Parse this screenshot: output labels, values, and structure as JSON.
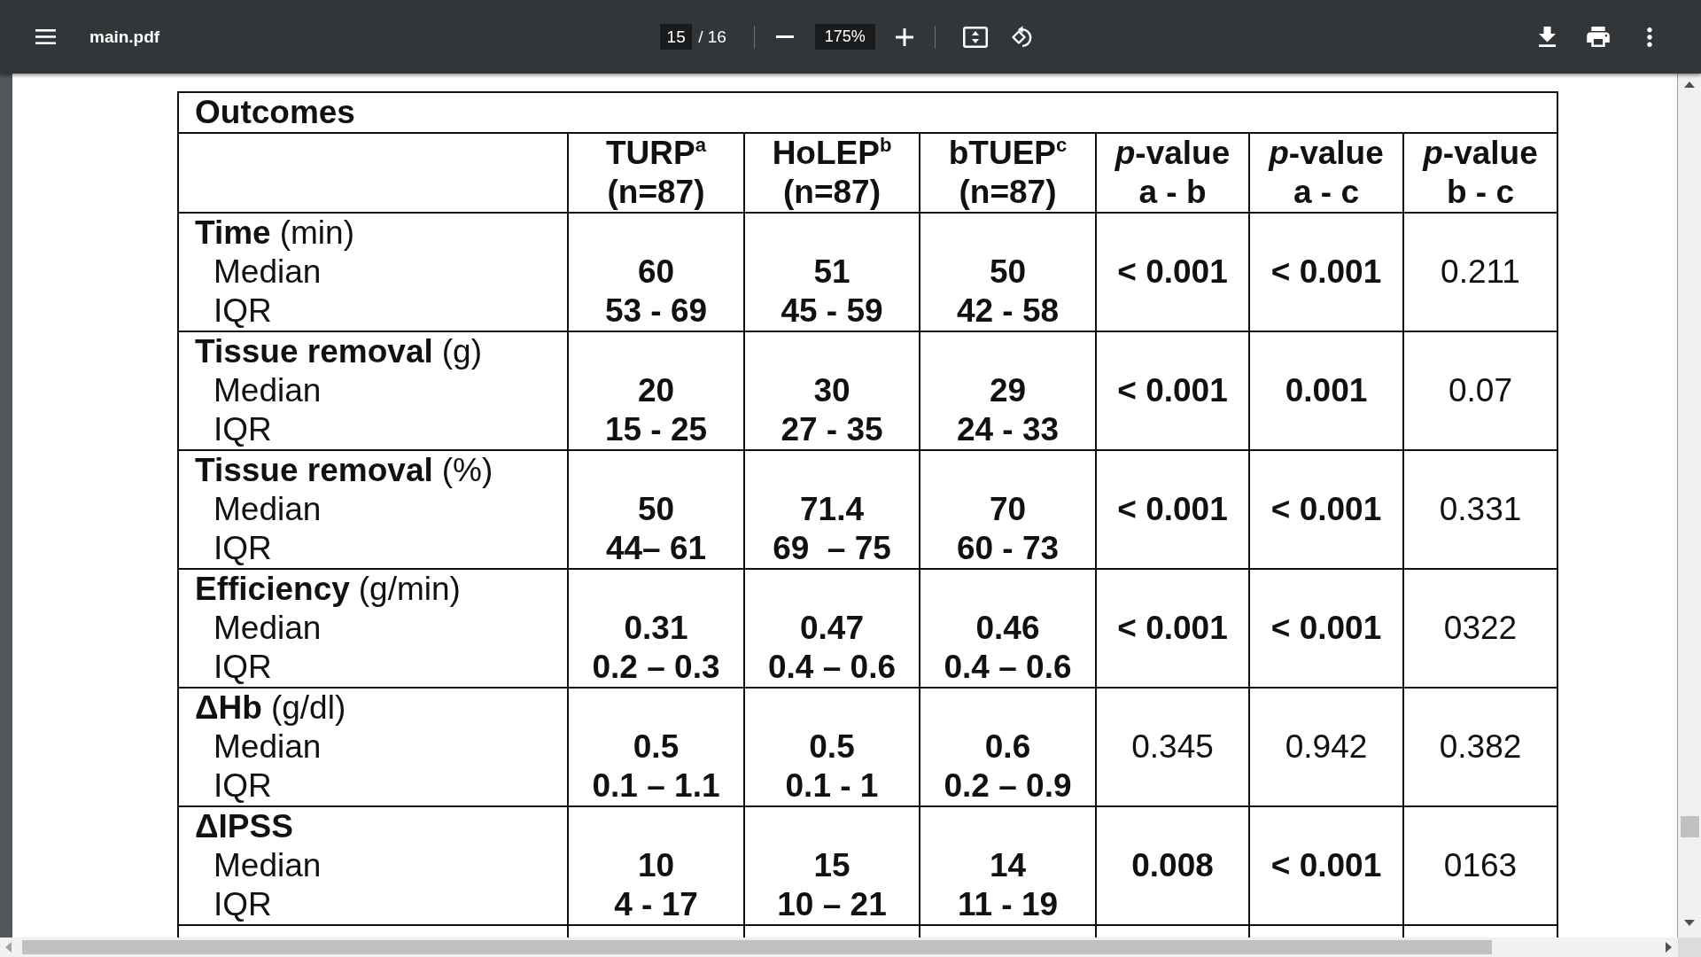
{
  "toolbar": {
    "file_name": "main.pdf",
    "page": "15",
    "page_total": "/ 16",
    "zoom": "175%"
  },
  "table": {
    "title": "Outcomes",
    "columns": [
      {
        "line_1": "TURP$^{a}$",
        "line_2": "(n=87)"
      },
      {
        "line_1": "HoLEP$^{b}$",
        "line_2": "(n=87)"
      },
      {
        "line_1": "bTUEP$^{c}$",
        "line_2": "(n=87)"
      },
      {
        "line_1": "*p*-value",
        "line_2": "a - b"
      },
      {
        "line_1": "*p*-value",
        "line_2": "a - c"
      },
      {
        "line_1": "*p*-value",
        "line_2": "b - c"
      }
    ],
    "rows": [
      {
        "label": "Time",
        "unit": "(min)",
        "median_label": "Median",
        "iqr_label": "IQR",
        "groups": [
          {
            "median": "60",
            "iqr": "53 - 69"
          },
          {
            "median": "51",
            "iqr": "45 - 59"
          },
          {
            "median": "50",
            "iqr": "42 - 58"
          }
        ],
        "p_values": [
          {
            "text": "< 0.001",
            "significant": true
          },
          {
            "text": "< 0.001",
            "significant": true
          },
          {
            "text": "0.211",
            "significant": false
          }
        ]
      },
      {
        "label": "Tissue removal",
        "unit": "(g)",
        "median_label": "Median",
        "iqr_label": "IQR",
        "groups": [
          {
            "median": "20",
            "iqr": "15 - 25"
          },
          {
            "median": "30",
            "iqr": "27 - 35"
          },
          {
            "median": "29",
            "iqr": "24 - 33"
          }
        ],
        "p_values": [
          {
            "text": "< 0.001",
            "significant": true
          },
          {
            "text": "0.001",
            "significant": true
          },
          {
            "text": "0.07",
            "significant": false
          }
        ]
      },
      {
        "label": "Tissue removal",
        "unit": "(%)",
        "median_label": "Median",
        "iqr_label": "IQR",
        "groups": [
          {
            "median": "50",
            "iqr": "44– 61"
          },
          {
            "median": "71.4",
            "iqr": "69  – 75"
          },
          {
            "median": "70",
            "iqr": "60 - 73"
          }
        ],
        "p_values": [
          {
            "text": "< 0.001",
            "significant": true
          },
          {
            "text": "< 0.001",
            "significant": true
          },
          {
            "text": "0.331",
            "significant": false
          }
        ]
      },
      {
        "label": "Efficiency",
        "unit": "(g/min)",
        "median_label": "Median",
        "iqr_label": "IQR",
        "groups": [
          {
            "median": "0.31",
            "iqr": "0.2 – 0.3"
          },
          {
            "median": "0.47",
            "iqr": "0.4 – 0.6"
          },
          {
            "median": "0.46",
            "iqr": "0.4 – 0.6"
          }
        ],
        "p_values": [
          {
            "text": "< 0.001",
            "significant": true
          },
          {
            "text": "< 0.001",
            "significant": true
          },
          {
            "text": "0322",
            "significant": false
          }
        ]
      },
      {
        "label": "ΔHb",
        "unit": "(g/dl)",
        "median_label": "Median",
        "iqr_label": "IQR",
        "groups": [
          {
            "median": "0.5",
            "iqr": "0.1 – 1.1"
          },
          {
            "median": "0.5",
            "iqr": "0.1 - 1"
          },
          {
            "median": "0.6",
            "iqr": "0.2 – 0.9"
          }
        ],
        "p_values": [
          {
            "text": "0.345",
            "significant": false
          },
          {
            "text": "0.942",
            "significant": false
          },
          {
            "text": "0.382",
            "significant": false
          }
        ]
      },
      {
        "label": "ΔIPSS",
        "median_label": "Median",
        "iqr_label": "IQR",
        "groups": [
          {
            "median": "10",
            "iqr": "4 - 17"
          },
          {
            "median": "15",
            "iqr": "10 – 21"
          },
          {
            "median": "14",
            "iqr": "11 - 19"
          }
        ],
        "p_values": [
          {
            "text": "0.008",
            "significant": true
          },
          {
            "text": "< 0.001",
            "significant": true
          },
          {
            "text": "0163",
            "significant": false
          }
        ]
      }
    ]
  }
}
